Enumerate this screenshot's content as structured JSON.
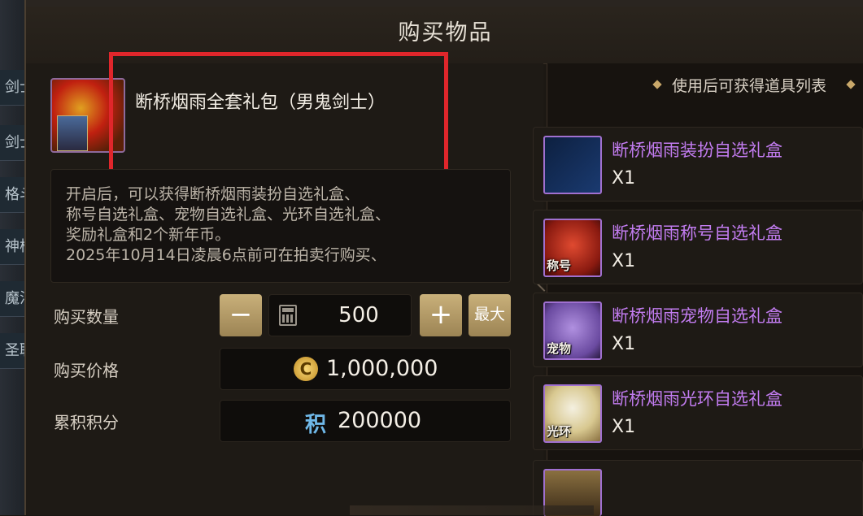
{
  "sidebar": {
    "items": [
      {
        "label": "剑士"
      },
      {
        "label": "剑士"
      },
      {
        "label": "格斗"
      },
      {
        "label": "神枪"
      },
      {
        "label": "魔法"
      },
      {
        "label": "圣职"
      }
    ]
  },
  "dialog": {
    "title": "购买物品",
    "item_name": "断桥烟雨全套礼包（男鬼剑士）",
    "description_lines": [
      "开启后，可以获得断桥烟雨装扮自选礼盒、",
      "称号自选礼盒、宠物自选礼盒、光环自选礼盒、",
      "奖励礼盒和2个新年币。",
      "2025年10月14日凌晨6点前可在拍卖行购买、"
    ],
    "quantity_label": "购买数量",
    "quantity_value": "500",
    "minus_label": "−",
    "plus_label": "+",
    "max_label": "最大",
    "price_label": "购买价格",
    "price_value": "1,000,000",
    "price_currency_icon": "gold-coin-icon",
    "points_label": "累积积分",
    "points_value": "200000",
    "points_icon_text": "积"
  },
  "rewards_panel": {
    "title": "使用后可获得道具列表",
    "items": [
      {
        "name": "断桥烟雨装扮自选礼盒",
        "qty": "X1",
        "tag": "",
        "icon": "outfit-icon"
      },
      {
        "name": "断桥烟雨称号自选礼盒",
        "qty": "X1",
        "tag": "称号",
        "icon": "gift-box-red-icon"
      },
      {
        "name": "断桥烟雨宠物自选礼盒",
        "qty": "X1",
        "tag": "宠物",
        "icon": "gift-box-purple-icon"
      },
      {
        "name": "断桥烟雨光环自选礼盒",
        "qty": "X1",
        "tag": "光环",
        "icon": "gift-box-gold-icon"
      }
    ]
  },
  "colors": {
    "accent_red_highlight": "#e0262b",
    "reward_name": "#c27cf0",
    "button_gold": "#c9b07a"
  }
}
